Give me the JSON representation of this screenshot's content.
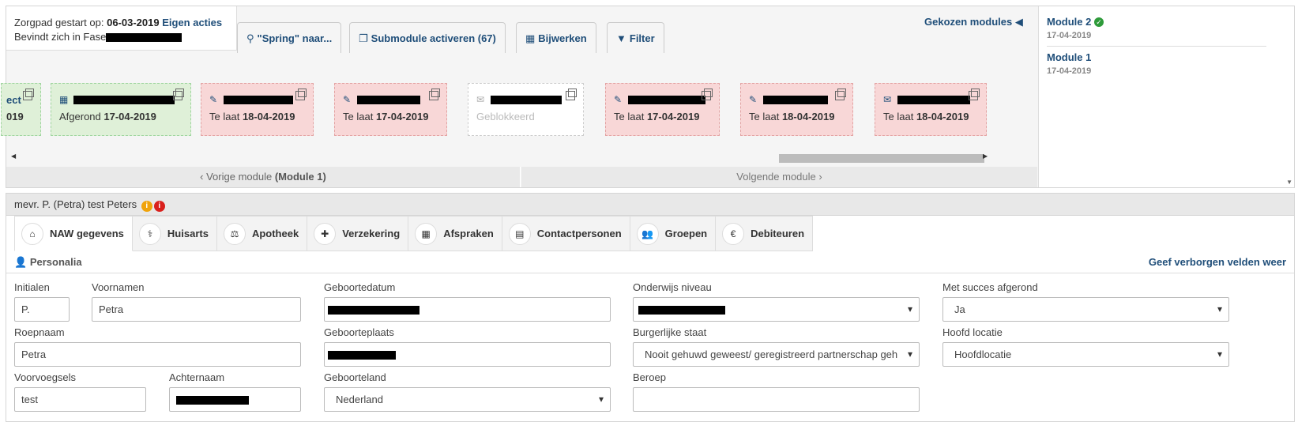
{
  "zorgpad": {
    "started_label": "Zorgpad gestart op:",
    "started_date": "06-03-2019",
    "own_actions": "Eigen acties",
    "phase_label": "Bevindt zich in Fase"
  },
  "top_tabs": [
    {
      "label": "\"Spring\" naar...",
      "icon": "map-marker-icon"
    },
    {
      "label": "Submodule activeren (67)",
      "icon": "copy-icon"
    },
    {
      "label": "Bijwerken",
      "icon": "calculator-icon"
    },
    {
      "label": "Filter",
      "icon": "filter-icon"
    }
  ],
  "gekozen_modules": "Gekozen modules",
  "cards": [
    {
      "title": "ect",
      "status_label": "",
      "status_date": "019",
      "style": "green"
    },
    {
      "title": "",
      "status_label": "Afgerond",
      "status_date": "17-04-2019",
      "style": "green",
      "icon": "calendar-icon"
    },
    {
      "title": "",
      "status_label": "Te laat",
      "status_date": "18-04-2019",
      "style": "red",
      "icon": "pencil-icon"
    },
    {
      "title": "",
      "status_label": "Te laat",
      "status_date": "17-04-2019",
      "style": "red",
      "icon": "pencil-icon"
    },
    {
      "title": "",
      "status_label": "Geblokkeerd",
      "status_date": "",
      "style": "white",
      "icon": "envelope-icon"
    },
    {
      "title": "",
      "status_label": "Te laat",
      "status_date": "17-04-2019",
      "style": "red",
      "icon": "edit-square-icon"
    },
    {
      "title": "",
      "status_label": "Te laat",
      "status_date": "18-04-2019",
      "style": "red",
      "icon": "pencil-icon"
    },
    {
      "title": "",
      "status_label": "Te laat",
      "status_date": "18-04-2019",
      "style": "red",
      "icon": "envelope-icon"
    }
  ],
  "nav": {
    "prev_label": "‹ Vorige module",
    "prev_module": "(Module 1)",
    "next_label": "Volgende module ›"
  },
  "modules": [
    {
      "name": "Module 2",
      "date": "17-04-2019",
      "completed": true
    },
    {
      "name": "Module 1",
      "date": "17-04-2019",
      "completed": false
    }
  ],
  "patient": {
    "name": "mevr. P. (Petra) test Peters",
    "info_badge": "i",
    "alert_badge": "i"
  },
  "patient_tabs": [
    {
      "label": "NAW gegevens",
      "icon": "home-icon",
      "glyph": "⌂"
    },
    {
      "label": "Huisarts",
      "icon": "doctor-icon",
      "glyph": "⚕"
    },
    {
      "label": "Apotheek",
      "icon": "scale-icon",
      "glyph": "⚖"
    },
    {
      "label": "Verzekering",
      "icon": "plus-square-icon",
      "glyph": "✚"
    },
    {
      "label": "Afspraken",
      "icon": "calendar-icon",
      "glyph": "▦"
    },
    {
      "label": "Contactpersonen",
      "icon": "contact-book-icon",
      "glyph": "▤"
    },
    {
      "label": "Groepen",
      "icon": "users-icon",
      "glyph": "👥"
    },
    {
      "label": "Debiteuren",
      "icon": "euro-icon",
      "glyph": "€"
    }
  ],
  "personalia": {
    "title": "Personalia",
    "show_hidden": "Geef verborgen velden weer"
  },
  "form": {
    "initialen": {
      "label": "Initialen",
      "value": "P."
    },
    "voornamen": {
      "label": "Voornamen",
      "value": "Petra"
    },
    "roepnaam": {
      "label": "Roepnaam",
      "value": "Petra"
    },
    "voorvoegsels": {
      "label": "Voorvoegsels",
      "value": "test"
    },
    "achternaam": {
      "label": "Achternaam",
      "value": ""
    },
    "geboortedatum": {
      "label": "Geboortedatum",
      "value": ""
    },
    "geboorteplaats": {
      "label": "Geboorteplaats",
      "value": ""
    },
    "geboorteland": {
      "label": "Geboorteland",
      "value": "Nederland"
    },
    "onderwijs": {
      "label": "Onderwijs niveau",
      "value": ""
    },
    "burgerlijke_staat": {
      "label": "Burgerlijke staat",
      "value": "Nooit gehuwd geweest/ geregistreerd partnerschap geh"
    },
    "beroep": {
      "label": "Beroep",
      "value": ""
    },
    "succes": {
      "label": "Met succes afgerond",
      "value": "Ja"
    },
    "hoofd_locatie": {
      "label": "Hoofd locatie",
      "value": "Hoofdlocatie"
    }
  }
}
